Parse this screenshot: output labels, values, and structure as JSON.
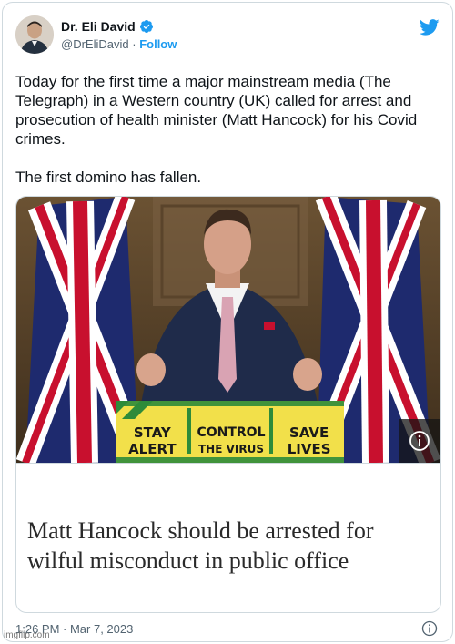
{
  "author": {
    "display_name": "Dr. Eli David",
    "handle": "@DrEliDavid",
    "separator": "·",
    "follow_label": "Follow",
    "verified": true
  },
  "tweet": {
    "text": "Today for the first time a major mainstream media (The Telegraph) in a Western country (UK) called for arrest and prosecution of health minister (Matt Hancock) for his Covid crimes.\n\nThe first domino has fallen."
  },
  "card": {
    "sign": {
      "col1_line1": "STAY",
      "col1_line2": "ALERT",
      "col2_line1": "CONTROL",
      "col2_line2": "THE VIRUS",
      "col3_line1": "SAVE",
      "col3_line2": "LIVES"
    },
    "headline": "Matt Hancock should be arrested for wilful misconduct in public office"
  },
  "footer": {
    "timestamp": "1:26 PM · Mar 7, 2023"
  },
  "watermark": "imgflip.com",
  "colors": {
    "brand_blue": "#1d9bf0",
    "text_primary": "#0f1419",
    "text_secondary": "#536471",
    "border": "#cfd9de",
    "sign_yellow": "#f2e04a",
    "sign_green": "#2e8b3a"
  },
  "icons": [
    "verified-badge-icon",
    "twitter-bird-icon",
    "info-icon"
  ]
}
